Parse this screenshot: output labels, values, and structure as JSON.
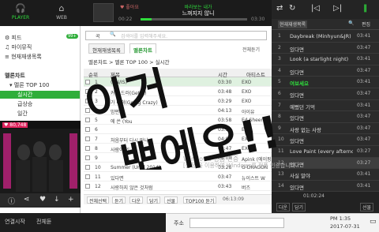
{
  "modes": {
    "player": "PLAYER",
    "web": "WEB"
  },
  "now_playing": {
    "liked": "♥ 좋아요",
    "artist_line": "바라보는 내가",
    "title_line": "느껴지지 않니",
    "current_time": "00:22",
    "total_time": "03:30",
    "progress": 0.1
  },
  "sidebar": {
    "items": [
      {
        "label": "피드",
        "badge": "99+"
      },
      {
        "label": "마이뮤직"
      },
      {
        "label": "현재재생목록"
      }
    ],
    "chart_header": "멜론차트",
    "chart_items": [
      {
        "label": "멜론 TOP 100"
      },
      {
        "label": "실시간",
        "selected": true
      },
      {
        "label": "급상승"
      },
      {
        "label": "일간"
      }
    ],
    "promo_likes": "♥ 80,748",
    "bottom": {
      "left": "연결시작",
      "right": "전체듣"
    }
  },
  "search": {
    "prefix": "곡",
    "placeholder": "검색어를 입력해주세요."
  },
  "center_tabs": [
    {
      "label": "현재재생목록"
    },
    {
      "label": "멜론차트",
      "active": true
    }
  ],
  "center_tabs_right": "전체듣기",
  "breadcrumb": "멜론차트 > 멜론 TOP 100 > 실시간",
  "table": {
    "headers": [
      "순위",
      "제목",
      "시간",
      "아티스트"
    ],
    "rows": [
      {
        "rank": "1",
        "title": "(CN/IS)",
        "time": "03:30",
        "artist": "EXO"
      },
      {
        "rank": "2",
        "title": "커피 드러(Get It)",
        "time": "03:48",
        "artist": "EXO"
      },
      {
        "rank": "3",
        "title": "가 미쳐(Going Crazy)",
        "time": "03:29",
        "artist": "EXO"
      },
      {
        "rank": "4",
        "title": "밤편지",
        "time": "04:13",
        "artist": "아이유"
      },
      {
        "rank": "5",
        "title": "에 쓴 (You",
        "time": "03:58",
        "artist": "Ed Sheeran"
      },
      {
        "rank": "6",
        "title": "",
        "time": "03:30",
        "artist": "EXO"
      },
      {
        "rank": "7",
        "title": "처음부터 다시 만나",
        "time": "04:03",
        "artist": "EXO"
      },
      {
        "rank": "8",
        "title": "사람이 있",
        "time": "03:47",
        "artist": "EXO"
      },
      {
        "rank": "9",
        "title": "",
        "time": "04:00",
        "artist": "Apink (에이핑크)"
      },
      {
        "rank": "10",
        "title": "Summer (Until 2014)",
        "time": "03:28",
        "artist": "G-DRAGON"
      },
      {
        "rank": "11",
        "title": "있다면",
        "time": "03:47",
        "artist": "뉴이스트 W"
      },
      {
        "rank": "12",
        "title": "사랑하지 않은 것처럼",
        "time": "03:43",
        "artist": "버즈"
      }
    ]
  },
  "actions": [
    {
      "label": "전체선택"
    },
    {
      "label": "듣기"
    },
    {
      "label": "다운"
    },
    {
      "label": "담기"
    },
    {
      "label": "선물"
    },
    {
      "label": "TOP100 듣기"
    }
  ],
  "table_footer_time": "06:13:09",
  "playlist": {
    "tabs": [
      {
        "label": "현재재생목록"
      },
      {
        "label": "🔍"
      },
      {
        "label": "편집"
      }
    ],
    "rows": [
      {
        "num": "1",
        "title": "Daybreak (Minhyun&JR)",
        "dur": "03:41"
      },
      {
        "num": "2",
        "title": "있다면",
        "dur": "03:47"
      },
      {
        "num": "3",
        "title": "Look (a starlight night)",
        "dur": "03:41"
      },
      {
        "num": "4",
        "title": "있다면",
        "dur": "03:47"
      },
      {
        "num": "5",
        "title": "여보세요",
        "dur": "03:41",
        "playing": true
      },
      {
        "num": "6",
        "title": "있다면",
        "dur": "03:47"
      },
      {
        "num": "7",
        "title": "예뻤던 기억",
        "dur": "03:41"
      },
      {
        "num": "8",
        "title": "있다면",
        "dur": "03:47"
      },
      {
        "num": "9",
        "title": "사랑 없는 사랑",
        "dur": "03:47"
      },
      {
        "num": "10",
        "title": "있다면",
        "dur": "03:47"
      },
      {
        "num": "11",
        "title": "Love Paint (every afternoon)",
        "dur": "03:27"
      },
      {
        "num": "12",
        "title": "있다면",
        "dur": "03:27",
        "selected": true
      },
      {
        "num": "13",
        "title": "사실 말야",
        "dur": "03:41"
      },
      {
        "num": "14",
        "title": "있다면",
        "dur": "03:41"
      }
    ],
    "footer_time": "01:02:24",
    "footer_buttons": [
      "다운",
      "담기",
      "선물"
    ]
  },
  "overlay_text": {
    "line1": "이거",
    "line2": "뽀에오!!"
  },
  "watermark": {
    "line1": "Windows 정품 인증",
    "line2": "[설정]을 이용하여 Windows를 정품 인증합니다."
  },
  "taskbar": {
    "address_label": "주소",
    "time": "PM 1:35",
    "date": "2017-07-31"
  },
  "colors": {
    "accent": "#2fdc3c",
    "accent_dark": "#2fae3a",
    "topbar": "#1b1b1b",
    "playlist_bg": "#2b2b2b"
  }
}
